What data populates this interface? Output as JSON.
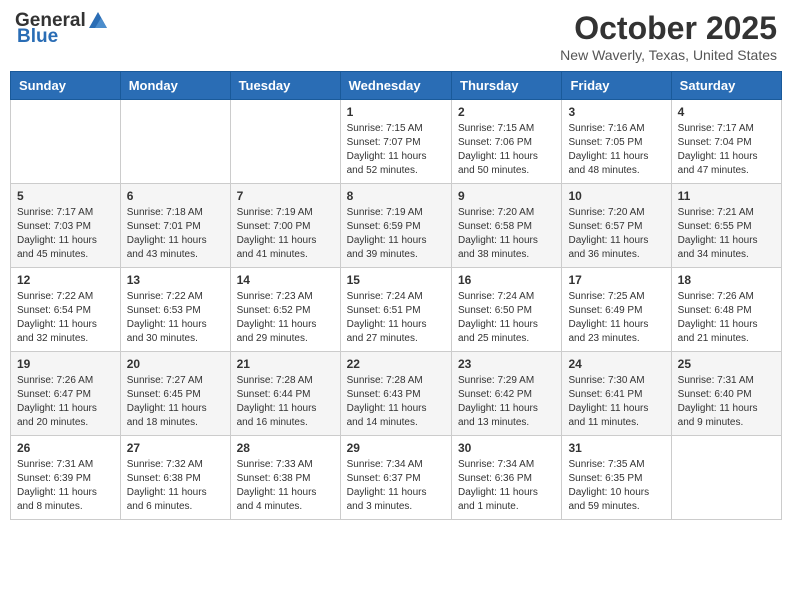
{
  "header": {
    "logo_general": "General",
    "logo_blue": "Blue",
    "month": "October 2025",
    "location": "New Waverly, Texas, United States"
  },
  "weekdays": [
    "Sunday",
    "Monday",
    "Tuesday",
    "Wednesday",
    "Thursday",
    "Friday",
    "Saturday"
  ],
  "weeks": [
    [
      {
        "day": "",
        "info": ""
      },
      {
        "day": "",
        "info": ""
      },
      {
        "day": "",
        "info": ""
      },
      {
        "day": "1",
        "info": "Sunrise: 7:15 AM\nSunset: 7:07 PM\nDaylight: 11 hours\nand 52 minutes."
      },
      {
        "day": "2",
        "info": "Sunrise: 7:15 AM\nSunset: 7:06 PM\nDaylight: 11 hours\nand 50 minutes."
      },
      {
        "day": "3",
        "info": "Sunrise: 7:16 AM\nSunset: 7:05 PM\nDaylight: 11 hours\nand 48 minutes."
      },
      {
        "day": "4",
        "info": "Sunrise: 7:17 AM\nSunset: 7:04 PM\nDaylight: 11 hours\nand 47 minutes."
      }
    ],
    [
      {
        "day": "5",
        "info": "Sunrise: 7:17 AM\nSunset: 7:03 PM\nDaylight: 11 hours\nand 45 minutes."
      },
      {
        "day": "6",
        "info": "Sunrise: 7:18 AM\nSunset: 7:01 PM\nDaylight: 11 hours\nand 43 minutes."
      },
      {
        "day": "7",
        "info": "Sunrise: 7:19 AM\nSunset: 7:00 PM\nDaylight: 11 hours\nand 41 minutes."
      },
      {
        "day": "8",
        "info": "Sunrise: 7:19 AM\nSunset: 6:59 PM\nDaylight: 11 hours\nand 39 minutes."
      },
      {
        "day": "9",
        "info": "Sunrise: 7:20 AM\nSunset: 6:58 PM\nDaylight: 11 hours\nand 38 minutes."
      },
      {
        "day": "10",
        "info": "Sunrise: 7:20 AM\nSunset: 6:57 PM\nDaylight: 11 hours\nand 36 minutes."
      },
      {
        "day": "11",
        "info": "Sunrise: 7:21 AM\nSunset: 6:55 PM\nDaylight: 11 hours\nand 34 minutes."
      }
    ],
    [
      {
        "day": "12",
        "info": "Sunrise: 7:22 AM\nSunset: 6:54 PM\nDaylight: 11 hours\nand 32 minutes."
      },
      {
        "day": "13",
        "info": "Sunrise: 7:22 AM\nSunset: 6:53 PM\nDaylight: 11 hours\nand 30 minutes."
      },
      {
        "day": "14",
        "info": "Sunrise: 7:23 AM\nSunset: 6:52 PM\nDaylight: 11 hours\nand 29 minutes."
      },
      {
        "day": "15",
        "info": "Sunrise: 7:24 AM\nSunset: 6:51 PM\nDaylight: 11 hours\nand 27 minutes."
      },
      {
        "day": "16",
        "info": "Sunrise: 7:24 AM\nSunset: 6:50 PM\nDaylight: 11 hours\nand 25 minutes."
      },
      {
        "day": "17",
        "info": "Sunrise: 7:25 AM\nSunset: 6:49 PM\nDaylight: 11 hours\nand 23 minutes."
      },
      {
        "day": "18",
        "info": "Sunrise: 7:26 AM\nSunset: 6:48 PM\nDaylight: 11 hours\nand 21 minutes."
      }
    ],
    [
      {
        "day": "19",
        "info": "Sunrise: 7:26 AM\nSunset: 6:47 PM\nDaylight: 11 hours\nand 20 minutes."
      },
      {
        "day": "20",
        "info": "Sunrise: 7:27 AM\nSunset: 6:45 PM\nDaylight: 11 hours\nand 18 minutes."
      },
      {
        "day": "21",
        "info": "Sunrise: 7:28 AM\nSunset: 6:44 PM\nDaylight: 11 hours\nand 16 minutes."
      },
      {
        "day": "22",
        "info": "Sunrise: 7:28 AM\nSunset: 6:43 PM\nDaylight: 11 hours\nand 14 minutes."
      },
      {
        "day": "23",
        "info": "Sunrise: 7:29 AM\nSunset: 6:42 PM\nDaylight: 11 hours\nand 13 minutes."
      },
      {
        "day": "24",
        "info": "Sunrise: 7:30 AM\nSunset: 6:41 PM\nDaylight: 11 hours\nand 11 minutes."
      },
      {
        "day": "25",
        "info": "Sunrise: 7:31 AM\nSunset: 6:40 PM\nDaylight: 11 hours\nand 9 minutes."
      }
    ],
    [
      {
        "day": "26",
        "info": "Sunrise: 7:31 AM\nSunset: 6:39 PM\nDaylight: 11 hours\nand 8 minutes."
      },
      {
        "day": "27",
        "info": "Sunrise: 7:32 AM\nSunset: 6:38 PM\nDaylight: 11 hours\nand 6 minutes."
      },
      {
        "day": "28",
        "info": "Sunrise: 7:33 AM\nSunset: 6:38 PM\nDaylight: 11 hours\nand 4 minutes."
      },
      {
        "day": "29",
        "info": "Sunrise: 7:34 AM\nSunset: 6:37 PM\nDaylight: 11 hours\nand 3 minutes."
      },
      {
        "day": "30",
        "info": "Sunrise: 7:34 AM\nSunset: 6:36 PM\nDaylight: 11 hours\nand 1 minute."
      },
      {
        "day": "31",
        "info": "Sunrise: 7:35 AM\nSunset: 6:35 PM\nDaylight: 10 hours\nand 59 minutes."
      },
      {
        "day": "",
        "info": ""
      }
    ]
  ]
}
